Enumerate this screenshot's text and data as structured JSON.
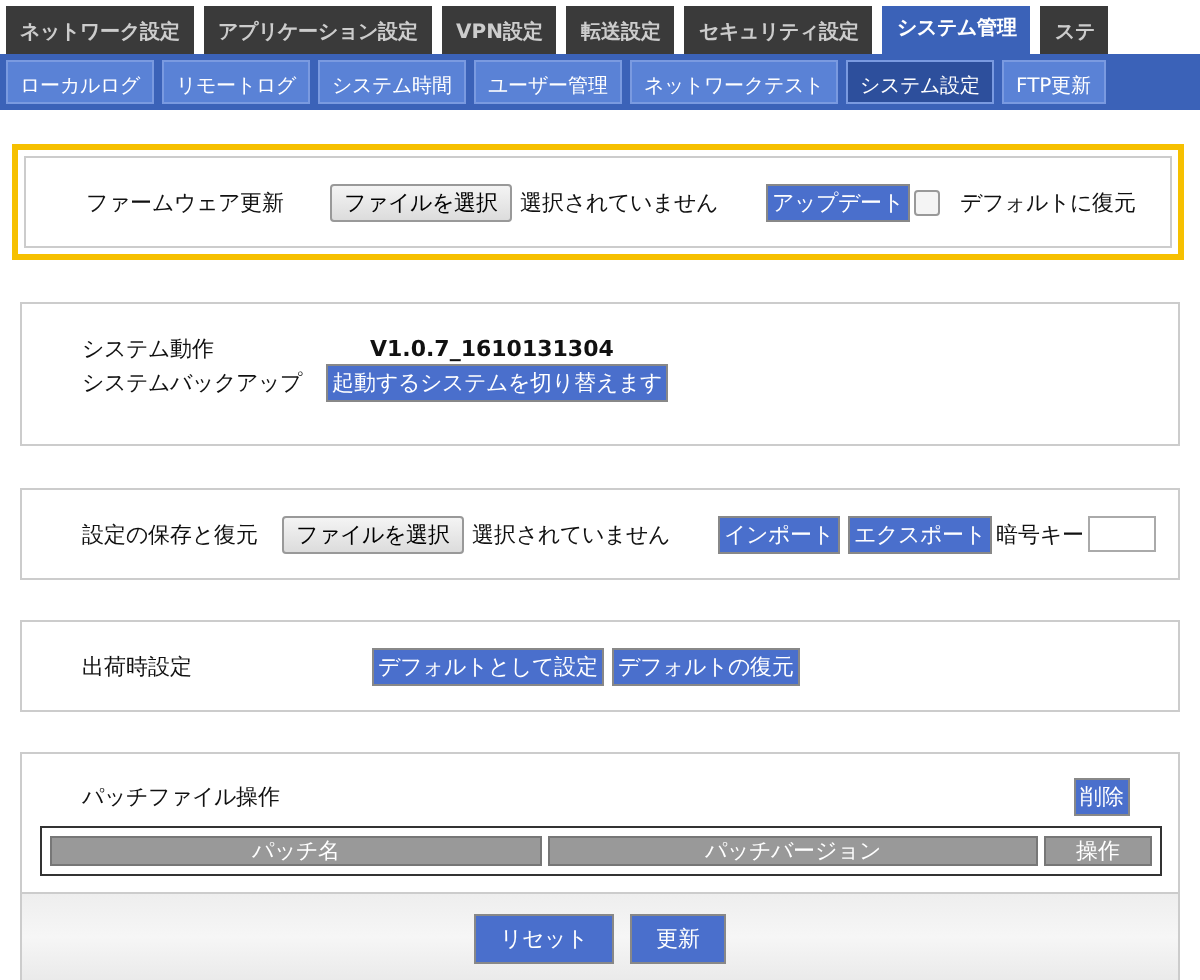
{
  "top_tabs": [
    {
      "label": "ネットワーク設定",
      "selected": false
    },
    {
      "label": "アプリケーション設定",
      "selected": false
    },
    {
      "label": "VPN設定",
      "selected": false
    },
    {
      "label": "転送設定",
      "selected": false
    },
    {
      "label": "セキュリティ設定",
      "selected": false
    },
    {
      "label": "システム管理",
      "selected": true
    },
    {
      "label": "ステ",
      "selected": false
    }
  ],
  "sub_tabs": [
    {
      "label": "ローカルログ",
      "selected": false
    },
    {
      "label": "リモートログ",
      "selected": false
    },
    {
      "label": "システム時間",
      "selected": false
    },
    {
      "label": "ユーザー管理",
      "selected": false
    },
    {
      "label": "ネットワークテスト",
      "selected": false
    },
    {
      "label": "システム設定",
      "selected": true
    },
    {
      "label": "FTP更新",
      "selected": false
    }
  ],
  "firmware": {
    "highlighted": true,
    "label": "ファームウェア更新",
    "file_button": "ファイルを選択",
    "file_status": "選択されていません",
    "update_button": "アップデート",
    "restore_default": {
      "label": "デフォルトに復元",
      "checked": false
    }
  },
  "system": {
    "rows": [
      {
        "kind": "value",
        "label": "システム動作",
        "value": "V1.0.7_1610131304"
      },
      {
        "kind": "button",
        "label": "システムバックアップ",
        "value": "起動するシステムを切り替えます"
      }
    ]
  },
  "backup": {
    "label": "設定の保存と復元",
    "file_button": "ファイルを選択",
    "file_status": "選択されていません",
    "buttons": [
      "インポート",
      "エクスポート"
    ],
    "key_label": "暗号キー"
  },
  "factory": {
    "label": "出荷時設定",
    "buttons": [
      "デフォルトとして設定",
      "デフォルトの復元"
    ]
  },
  "patch": {
    "title": "パッチファイル操作",
    "delete_button": "削除",
    "columns": [
      "パッチ名",
      "パッチバージョン",
      "操作"
    ],
    "footer_buttons": [
      "リセット",
      "更新"
    ]
  }
}
